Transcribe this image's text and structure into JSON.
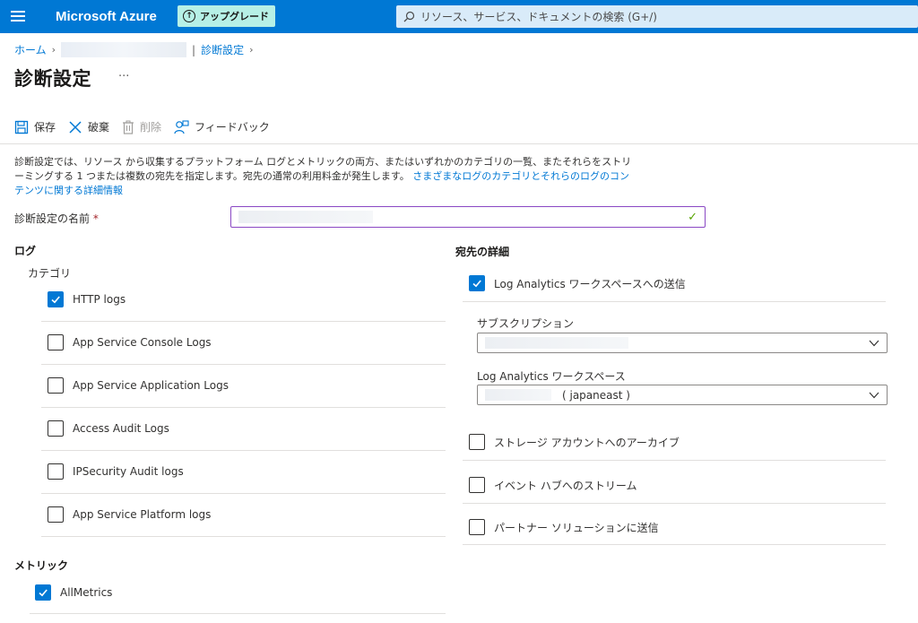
{
  "header": {
    "brand": "Microsoft Azure",
    "upgrade_label": "アップグレード",
    "search_placeholder": "リソース、サービス、ドキュメントの検索 (G+/)"
  },
  "breadcrumb": {
    "home": "ホーム",
    "current": "診断設定"
  },
  "page": {
    "title": "診断設定",
    "more": "···"
  },
  "toolbar": {
    "save": "保存",
    "discard": "破棄",
    "delete": "削除",
    "feedback": "フィードバック"
  },
  "description": {
    "text": "診断設定では、リソース から収集するプラットフォーム ログとメトリックの両方、またはいずれかのカテゴリの一覧、またそれらをストリーミングする 1 つまたは複数の宛先を指定します。宛先の通常の利用料金が発生します。",
    "link": "さまざまなログのカテゴリとそれらのログのコンテンツに関する詳細情報"
  },
  "name_field": {
    "label": "診断設定の名前",
    "required_mark": "*"
  },
  "logs": {
    "heading": "ログ",
    "category_label": "カテゴリ",
    "items": [
      {
        "label": "HTTP logs",
        "checked": true
      },
      {
        "label": "App Service Console Logs",
        "checked": false
      },
      {
        "label": "App Service Application Logs",
        "checked": false
      },
      {
        "label": "Access Audit Logs",
        "checked": false
      },
      {
        "label": "IPSecurity Audit logs",
        "checked": false
      },
      {
        "label": "App Service Platform logs",
        "checked": false
      }
    ]
  },
  "metrics": {
    "heading": "メトリック",
    "items": [
      {
        "label": "AllMetrics",
        "checked": true
      }
    ]
  },
  "destination": {
    "heading": "宛先の詳細",
    "log_analytics": {
      "label": "Log Analytics ワークスペースへの送信",
      "checked": true
    },
    "subscription_label": "サブスクリプション",
    "workspace_label": "Log Analytics ワークスペース",
    "workspace_region": "( japaneast )",
    "storage": {
      "label": "ストレージ アカウントへのアーカイブ",
      "checked": false
    },
    "event_hub": {
      "label": "イベント ハブへのストリーム",
      "checked": false
    },
    "partner": {
      "label": "パートナー ソリューションに送信",
      "checked": false
    }
  }
}
